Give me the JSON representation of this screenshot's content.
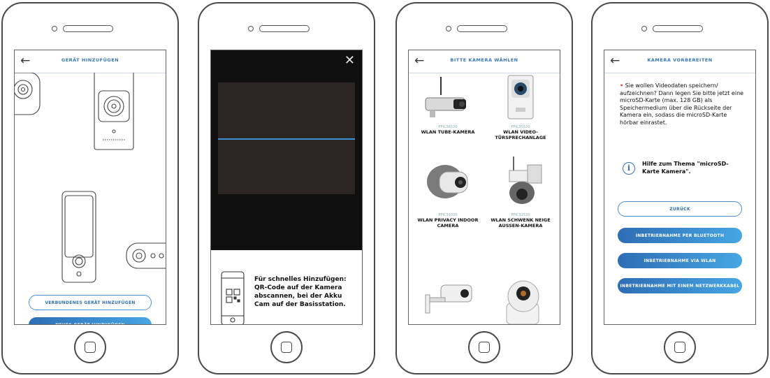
{
  "phone1": {
    "title": "GERÄT HINZUFÜGEN",
    "back_icon": "arrow-left-icon",
    "btn_connected": "VERBUNDENES GERÄT HINZUFÜGEN",
    "btn_new": "NEUES GERÄT HINZUFÜGEN"
  },
  "phone2": {
    "close_icon": "close-icon",
    "qr_text": "Für schnelles Hinzufügen: QR-Code auf der Kamera abscannen, bei der Akku Cam auf der Basisstation."
  },
  "phone3": {
    "title": "BITTE KAMERA WÄHLEN",
    "back_icon": "arrow-left-icon",
    "cameras": [
      {
        "model": "PPIC36520",
        "name": "WLAN TUBE-KAMERA"
      },
      {
        "model": "PPIC35520",
        "name": "WLAN VIDEO-TÜRSPRECHANLAGE"
      },
      {
        "model": "PPIC31020",
        "name": "WLAN PRIVACY INDOOR CAMERA"
      },
      {
        "model": "PPIC32520",
        "name": "WLAN SCHWENK NEIGE AUSSEN-KAMERA"
      }
    ]
  },
  "phone4": {
    "title": "KAMERA VORBEREITEN",
    "back_icon": "arrow-left-icon",
    "bullet": "•",
    "info": "Sie wollen Videodaten speichern/ aufzeichnen? Dann legen Sie bitte jetzt eine microSD-Karte (max. 128 GB) als Speichermedium über die Rückseite der Kamera ein, sodass die microSD-Karte hörbar einrastet.",
    "help_icon": "info-icon",
    "help_text": "Hilfe zum Thema \"microSD-Karte Kamera\".",
    "btn_back": "ZURÜCK",
    "btn_bluetooth": "INBETRIEBNAHME PER BLUETOOTH",
    "btn_wlan": "INBETRIEBNAHME VIA WLAN",
    "btn_cable": "INBETRIEBNAHME MIT EINEM NETZWERKKABEL"
  },
  "colors": {
    "accent": "#2f6fb0",
    "accent_light": "#46a6e4",
    "outline": "#4a4a4a"
  }
}
